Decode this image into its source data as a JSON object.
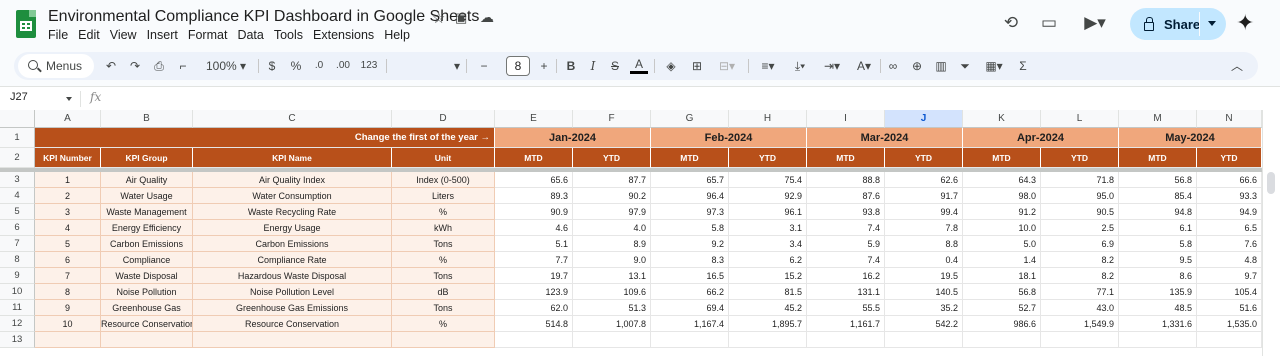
{
  "app": {
    "title": "Environmental Compliance KPI Dashboard in Google Sheets",
    "menu": [
      "File",
      "Edit",
      "View",
      "Insert",
      "Format",
      "Data",
      "Tools",
      "Extensions",
      "Help"
    ],
    "share_label": "Share"
  },
  "toolbar": {
    "search_label": "Menus",
    "zoom": "100%",
    "currency": "$",
    "percent": "%",
    "dec_decrease": ".0",
    "dec_increase": ".00",
    "number_format": "123",
    "font_size": "8",
    "minus": "−",
    "plus": "+",
    "bold": "B",
    "italic": "I",
    "sum": "Σ"
  },
  "formula_bar": {
    "name_box": "J27",
    "fx": "fx",
    "content": ""
  },
  "sheet": {
    "columns": [
      "A",
      "B",
      "C",
      "D",
      "E",
      "F",
      "G",
      "H",
      "I",
      "J",
      "K",
      "L",
      "M",
      "N"
    ],
    "selected_column": "J",
    "row_numbers": [
      "1",
      "2",
      "3",
      "4",
      "5",
      "6",
      "7",
      "8",
      "9",
      "10",
      "11",
      "12",
      "13"
    ],
    "banner": "Change the first of the year →",
    "months": [
      "Jan-2024",
      "Feb-2024",
      "Mar-2024",
      "Apr-2024",
      "May-2024"
    ],
    "headers": [
      "KPI Number",
      "KPI Group",
      "KPI Name",
      "Unit"
    ],
    "sub_headers": [
      "MTD",
      "YTD",
      "MTD",
      "YTD",
      "MTD",
      "YTD",
      "MTD",
      "YTD",
      "MTD",
      "YTD"
    ],
    "rows": [
      [
        "1",
        "Air Quality",
        "Air Quality Index",
        "Index (0-500)",
        "65.6",
        "87.7",
        "65.7",
        "75.4",
        "88.8",
        "62.6",
        "64.3",
        "71.8",
        "56.8",
        "66.6"
      ],
      [
        "2",
        "Water Usage",
        "Water Consumption",
        "Liters",
        "89.3",
        "90.2",
        "96.4",
        "92.9",
        "87.6",
        "91.7",
        "98.0",
        "95.0",
        "85.4",
        "93.3"
      ],
      [
        "3",
        "Waste Management",
        "Waste Recycling Rate",
        "%",
        "90.9",
        "97.9",
        "97.3",
        "96.1",
        "93.8",
        "99.4",
        "91.2",
        "90.5",
        "94.8",
        "94.9"
      ],
      [
        "4",
        "Energy Efficiency",
        "Energy Usage",
        "kWh",
        "4.6",
        "4.0",
        "5.8",
        "3.1",
        "7.4",
        "7.8",
        "10.0",
        "2.5",
        "6.1",
        "6.5"
      ],
      [
        "5",
        "Carbon Emissions",
        "Carbon Emissions",
        "Tons",
        "5.1",
        "8.9",
        "9.2",
        "3.4",
        "5.9",
        "8.8",
        "5.0",
        "6.9",
        "5.8",
        "7.6"
      ],
      [
        "6",
        "Compliance",
        "Compliance Rate",
        "%",
        "7.7",
        "9.0",
        "8.3",
        "6.2",
        "7.4",
        "0.4",
        "1.4",
        "8.2",
        "9.5",
        "4.8"
      ],
      [
        "7",
        "Waste Disposal",
        "Hazardous Waste Disposal",
        "Tons",
        "19.7",
        "13.1",
        "16.5",
        "15.2",
        "16.2",
        "19.5",
        "18.1",
        "8.2",
        "8.6",
        "9.7"
      ],
      [
        "8",
        "Noise Pollution",
        "Noise Pollution Level",
        "dB",
        "123.9",
        "109.6",
        "66.2",
        "81.5",
        "131.1",
        "140.5",
        "56.8",
        "77.1",
        "135.9",
        "105.4"
      ],
      [
        "9",
        "Greenhouse Gas",
        "Greenhouse Gas Emissions",
        "Tons",
        "62.0",
        "51.3",
        "69.4",
        "45.2",
        "55.5",
        "35.2",
        "52.7",
        "43.0",
        "48.5",
        "51.6"
      ],
      [
        "10",
        "Resource Conservation",
        "Resource Conservation",
        "%",
        "514.8",
        "1,007.8",
        "1,167.4",
        "1,895.7",
        "1,161.7",
        "542.2",
        "986.6",
        "1,549.9",
        "1,331.6",
        "1,535.0"
      ]
    ]
  },
  "colors": {
    "header_dark": "#b8501a",
    "header_light": "#f0a77c",
    "cell_light": "#fdf1e9",
    "share_bg": "#c2e7ff",
    "brand_green": "#1e8e3e"
  }
}
